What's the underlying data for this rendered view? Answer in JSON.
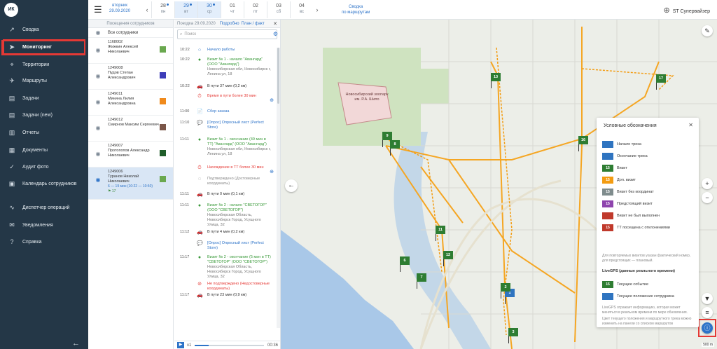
{
  "app": {
    "logo": "ИК"
  },
  "sidebar": {
    "items": [
      {
        "label": "Сводка",
        "icon": "chart-icon"
      },
      {
        "label": "Мониторинг",
        "icon": "navigation-arrow-icon",
        "active": true
      },
      {
        "label": "Территории",
        "icon": "map-pin-icon"
      },
      {
        "label": "Маршруты",
        "icon": "walking-person-icon"
      },
      {
        "label": "Задачи",
        "icon": "clipboard-icon"
      },
      {
        "label": "Задачи (new)",
        "icon": "clipboard-icon"
      },
      {
        "label": "Отчеты",
        "icon": "bar-chart-icon"
      },
      {
        "label": "Документы",
        "icon": "document-icon"
      },
      {
        "label": "Аудит фото",
        "icon": "photo-audit-icon"
      },
      {
        "label": "Календарь сотрудников",
        "icon": "calendar-icon"
      },
      {
        "label": "Диспетчер операций",
        "icon": "wave-icon"
      },
      {
        "label": "Уведомления",
        "icon": "envelope-icon"
      },
      {
        "label": "Справка",
        "icon": "help-icon"
      }
    ],
    "collapse": "←"
  },
  "header": {
    "weekday": "вторник",
    "date": "29.09.2020",
    "days": [
      {
        "num": "28",
        "wd": "пн",
        "dot": true
      },
      {
        "num": "29",
        "wd": "вт",
        "dot": true,
        "selected": true
      },
      {
        "num": "30",
        "wd": "ср",
        "dot": true,
        "selected": true
      },
      {
        "num": "01",
        "wd": "чт"
      },
      {
        "num": "02",
        "wd": "пт"
      },
      {
        "num": "03",
        "wd": "сб"
      },
      {
        "num": "04",
        "wd": "вс"
      }
    ],
    "summary_line1": "Сводка",
    "summary_line2": "по маршрутам",
    "user": "ST Супервайзер"
  },
  "employees": {
    "header": "Посещения сотрудников",
    "all_label": "Все сотрудники",
    "rows": [
      {
        "id": "1168002",
        "name": "Жижкин Алексей Николаевич",
        "color": "#6aa84f"
      },
      {
        "id": "1249008",
        "name": "Пудов Степан Александрович",
        "color": "#3d3db8"
      },
      {
        "id": "1249011",
        "name": "Минина Лилия Александровна",
        "color": "#f08a1c"
      },
      {
        "id": "1249012",
        "name": "Смирнов Максим Сергеевич",
        "color": "#7a5648"
      },
      {
        "id": "1249007",
        "name": "Протопопов Александр Николаевич",
        "color": "#1f5d2a"
      },
      {
        "id": "1249006",
        "name": "Туранов Николай Николаевич",
        "color": "#6aa84f",
        "selected": true,
        "extra": "6 — 19 мин (10:22 — 10:50)",
        "flag": "17"
      }
    ]
  },
  "timeline": {
    "title": "Поездка 29.09.2020",
    "link1": "Подробно",
    "link2": "План / факт",
    "search_placeholder": "Поиск",
    "events": [
      {
        "time": "10:22",
        "marker": "○",
        "cls": "blue",
        "text": "Начало работы"
      },
      {
        "time": "10:22",
        "marker": "●",
        "cls": "green",
        "text": "Визит № 1 - начало \"Авангард\" (ООО \"Авангард\")",
        "addr": "Новосибирская обл, Новосибирск г, Ленина ул, 18"
      },
      {
        "time": "10:22",
        "marker": "🚗",
        "cls": "",
        "text": "В пути 37 мин (0,2 км)"
      },
      {
        "time": "",
        "marker": "⏱",
        "cls": "red",
        "text": "Время в пути более 30 мин",
        "plus": "+"
      },
      {
        "time": "11:00",
        "marker": "📄",
        "cls": "blue",
        "text": "Сбор заказа"
      },
      {
        "time": "11:10",
        "marker": "💬",
        "cls": "blue",
        "text": "[Опрос] Опросный лист (Perfect Store)"
      },
      {
        "time": "11:11",
        "marker": "●",
        "cls": "green",
        "text": "Визит № 1 - окончание (49 мин в ТТ) \"Авангард\" (ООО \"Авангард\")",
        "addr": "Новосибирская обл, Новосибирск г, Ленина ул, 18"
      },
      {
        "time": "",
        "marker": "⏱",
        "cls": "red",
        "text": "Нахождение в ТТ более 30 мин",
        "plus": "+"
      },
      {
        "time": "",
        "marker": "◌",
        "cls": "gray",
        "text": "Подтверждено (Достоверные координаты)"
      },
      {
        "time": "11:11",
        "marker": "🚗",
        "cls": "",
        "text": "В пути 0 мин (0,1 км)"
      },
      {
        "time": "11:11",
        "marker": "●",
        "cls": "green",
        "text": "Визит № 2 - начало \"СВЕТОГОР\" (ООО \"СВЕТОГОР\")",
        "addr": "Новосибирская Область, Новосибирск Город, Усущного Улица, 32"
      },
      {
        "time": "11:12",
        "marker": "🚗",
        "cls": "",
        "text": "В пути 4 мин (0,2 км)"
      },
      {
        "time": "",
        "marker": "💬",
        "cls": "blue",
        "text": "[Опрос] Опросный лист (Perfect Store)"
      },
      {
        "time": "11:17",
        "marker": "●",
        "cls": "green",
        "text": "Визит № 2 - окончание (5 мин в ТТ) \"СВЕТОГОР\" (ООО \"СВЕТОГОР\")",
        "addr": "Новосибирская Область, Новосибирск Город, Усущного Улица, 32"
      },
      {
        "time": "",
        "marker": "⊘",
        "cls": "red",
        "text": "Не подтверждено (Недостоверные координаты)"
      },
      {
        "time": "11:17",
        "marker": "🚗",
        "cls": "",
        "text": "В пути 23 мин (0,9 км)"
      }
    ],
    "player": {
      "speed": "x1",
      "time": "00:36",
      "progress": 0.2
    }
  },
  "map": {
    "zoo_label": "Новосибирский зоопарк им. Р.А. Шило",
    "scale": "500 m",
    "markers": [
      {
        "label": "13"
      },
      {
        "label": "17"
      },
      {
        "label": "9"
      },
      {
        "label": "8"
      },
      {
        "label": "11"
      },
      {
        "label": "12"
      },
      {
        "label": "6"
      },
      {
        "label": "7"
      },
      {
        "label": "1"
      },
      {
        "label": "2"
      },
      {
        "label": "3"
      },
      {
        "label": "16"
      }
    ]
  },
  "legend": {
    "title": "Условные обозначения",
    "rows": [
      {
        "sw": "",
        "color": "#2f74c0",
        "label": "Начало трека"
      },
      {
        "sw": "",
        "color": "#2f74c0",
        "label": "Окончание трека"
      },
      {
        "sw": "15",
        "color": "#2e7d32",
        "label": "Визит"
      },
      {
        "sw": "15",
        "color": "#f39c12",
        "label": "Доп. визит"
      },
      {
        "sw": "15",
        "color": "#7f8c8d",
        "label": "Визит без координат"
      },
      {
        "sw": "15",
        "color": "#8e44ad",
        "label": "Предстоящий визит"
      },
      {
        "sw": "",
        "color": "#c0392b",
        "label": "Визит не был выполнен"
      },
      {
        "sw": "15",
        "color": "#c0392b",
        "label": "ТТ посещена с отклонениями"
      }
    ],
    "note1": "Для повторяемых визитов указан фактический номер, для предстоящих — плановый.",
    "livegps_title": "LiveGPS (данные реального времени)",
    "live_rows": [
      {
        "sw": "15",
        "color": "#2e7d32",
        "label": "Текущее событие"
      },
      {
        "sw": "",
        "color": "#2f74c0",
        "label": "Текущее положение сотрудника"
      }
    ],
    "note2": "LiveGPS отражает информацию, которая может меняться в реальном времени по мере обновления.",
    "note3": "Цвет текущего положения и маршрутного трека можно изменить на панели со списком маршрутов"
  },
  "colors": {
    "sidebar": "#243747",
    "accent": "#2d73c8",
    "route": "#f39c12",
    "highlight": "#e53935"
  }
}
